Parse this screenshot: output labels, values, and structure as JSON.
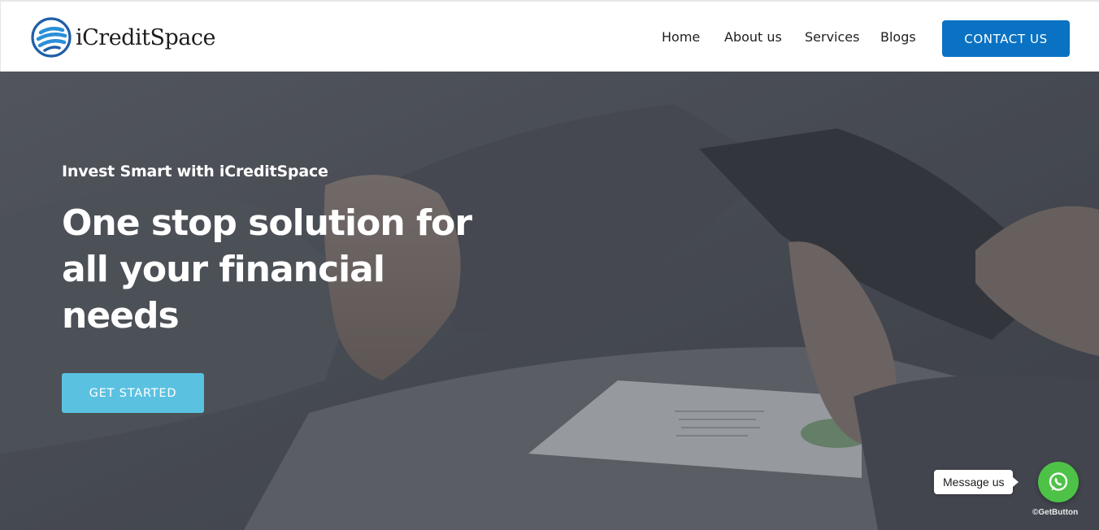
{
  "brand": {
    "name": "iCreditSpace",
    "logo_icon": "globe-stripes-icon",
    "colors": {
      "ring": "#1f5fa8",
      "stripes": "#2b8fd8"
    }
  },
  "nav": {
    "items": [
      {
        "label": "Home"
      },
      {
        "label": "About us"
      },
      {
        "label": "Services"
      },
      {
        "label": "Blogs"
      }
    ],
    "contact_label": "CONTACT US",
    "contact_color": "#0a72c2"
  },
  "hero": {
    "eyebrow": "Invest Smart with iCreditSpace",
    "title_lines": [
      "One stop solution for",
      "all your financial",
      "needs"
    ],
    "cta_label": "GET STARTED",
    "cta_color": "#5bc1e1"
  },
  "widget": {
    "message_label": "Message us",
    "icon": "whatsapp-icon",
    "color": "#4dc247",
    "powered_by": "GetButton"
  }
}
